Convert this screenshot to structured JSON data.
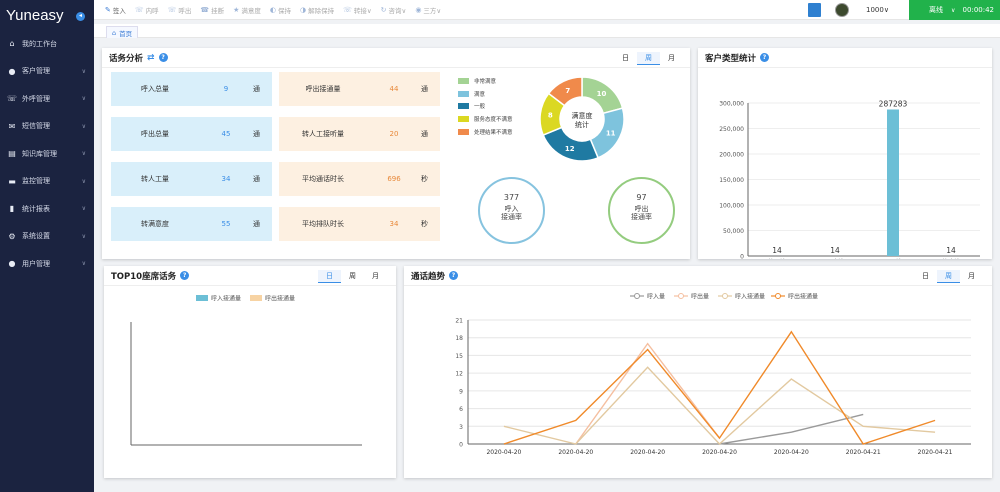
{
  "app": {
    "logo": "Yuneasy"
  },
  "sidebar": {
    "items": [
      {
        "label": "我的工作台",
        "icon": "home-icon",
        "glyph": "⌂",
        "arrow": ""
      },
      {
        "label": "客户管理",
        "icon": "user-icon",
        "glyph": "●",
        "arrow": "∨"
      },
      {
        "label": "外呼管理",
        "icon": "phone-icon",
        "glyph": "☏",
        "arrow": "∨"
      },
      {
        "label": "短信管理",
        "icon": "mail-icon",
        "glyph": "✉",
        "arrow": "∨"
      },
      {
        "label": "知识库管理",
        "icon": "knowledge-icon",
        "glyph": "▤",
        "arrow": "∨"
      },
      {
        "label": "监控管理",
        "icon": "monitor-icon",
        "glyph": "▬",
        "arrow": "∨"
      },
      {
        "label": "统计报表",
        "icon": "report-icon",
        "glyph": "▮",
        "arrow": "∨"
      },
      {
        "label": "系统设置",
        "icon": "settings-icon",
        "glyph": "⚙",
        "arrow": "∨"
      },
      {
        "label": "用户管理",
        "icon": "users-icon",
        "glyph": "●",
        "arrow": "∨"
      }
    ]
  },
  "toolbar": {
    "items": [
      {
        "label": "签入",
        "icon": "sign-in-icon",
        "glyph": "✎",
        "enabled": true
      },
      {
        "label": "内呼",
        "icon": "internal-call-icon",
        "glyph": "☏",
        "enabled": false
      },
      {
        "label": "呼出",
        "icon": "outbound-call-icon",
        "glyph": "☏",
        "enabled": false
      },
      {
        "label": "挂断",
        "icon": "hangup-icon",
        "glyph": "☎",
        "enabled": false
      },
      {
        "label": "满意度",
        "icon": "satisfaction-icon",
        "glyph": "★",
        "enabled": false
      },
      {
        "label": "保持",
        "icon": "hold-icon",
        "glyph": "◐",
        "enabled": false
      },
      {
        "label": "解除保持",
        "icon": "unhold-icon",
        "glyph": "◑",
        "enabled": false
      },
      {
        "label": "转接∨",
        "icon": "transfer-icon",
        "glyph": "☏",
        "enabled": false
      },
      {
        "label": "咨询∨",
        "icon": "consult-icon",
        "glyph": "↻",
        "enabled": false
      },
      {
        "label": "三方∨",
        "icon": "three-way-icon",
        "glyph": "◉",
        "enabled": false
      }
    ],
    "extension": "1000∨"
  },
  "status": {
    "label": "离线",
    "arrow": "∨",
    "timer": "00:00:42"
  },
  "breadcrumb": {
    "home": "首页"
  },
  "tabs_dwm": [
    "日",
    "周",
    "月"
  ],
  "call_analysis": {
    "title": "话务分析",
    "stats_left": [
      {
        "label": "呼入总量",
        "value": "9",
        "unit": "通"
      },
      {
        "label": "呼出总量",
        "value": "45",
        "unit": "通"
      },
      {
        "label": "转人工量",
        "value": "34",
        "unit": "通"
      },
      {
        "label": "转满意度",
        "value": "55",
        "unit": "通"
      }
    ],
    "stats_right": [
      {
        "label": "呼出接通量",
        "value": "44",
        "unit": "通"
      },
      {
        "label": "转人工接听量",
        "value": "20",
        "unit": "通"
      },
      {
        "label": "平均通话时长",
        "value": "696",
        "unit": "秒"
      },
      {
        "label": "平均排队时长",
        "value": "34",
        "unit": "秒"
      }
    ],
    "legend": [
      {
        "label": "非常满意",
        "color": "#a4d394"
      },
      {
        "label": "满意",
        "color": "#7ec3dd"
      },
      {
        "label": "一般",
        "color": "#1f7aa2"
      },
      {
        "label": "服务态度不满意",
        "color": "#dbd822"
      },
      {
        "label": "处理结果不满意",
        "color": "#f08a4b"
      }
    ],
    "donut": {
      "center": "满意度\n统计",
      "values": [
        10,
        11,
        12,
        8,
        7
      ]
    },
    "inbound_rate": {
      "value": "377",
      "label": "呼入\n接通率",
      "color": "#86c3df"
    },
    "outbound_rate": {
      "value": "97",
      "label": "呼出\n接通率",
      "color": "#94cc7f"
    }
  },
  "customer_stats": {
    "title": "客户类型统计",
    "chart_data": {
      "type": "bar",
      "categories": [
        "待回访",
        "已确认",
        "已回访",
        "待确认"
      ],
      "values": [
        14,
        14,
        287283,
        14
      ],
      "ylim": [
        0,
        300000
      ],
      "yticks": [
        "300,000",
        "250,000",
        "200,000",
        "150,000",
        "100,000",
        "50,000",
        "0"
      ],
      "color": "#6cbfd6"
    }
  },
  "top10": {
    "title": "TOP10座席话务",
    "chart_data": {
      "type": "bar",
      "series": [
        {
          "name": "呼入接通量",
          "color": "#6cbfd6",
          "values": []
        },
        {
          "name": "呼出接通量",
          "color": "#f7d3a3",
          "values": []
        }
      ],
      "categories": []
    }
  },
  "call_trend": {
    "title": "通话趋势",
    "chart_data": {
      "type": "line",
      "x": [
        "2020-04-20",
        "2020-04-20",
        "2020-04-20",
        "2020-04-20",
        "2020-04-20",
        "2020-04-21",
        "2020-04-21"
      ],
      "ylim": [
        0,
        21
      ],
      "yticks": [
        "21",
        "18",
        "15",
        "12",
        "9",
        "6",
        "3",
        "0"
      ],
      "series": [
        {
          "name": "呼入量",
          "color": "#9a9a9a",
          "values": [
            0,
            0,
            0,
            0,
            2,
            5,
            null
          ]
        },
        {
          "name": "呼出量",
          "color": "#f5bfa0",
          "values": [
            null,
            0,
            17,
            1,
            null,
            null,
            null
          ]
        },
        {
          "name": "呼入接通量",
          "color": "#e2c9a0",
          "values": [
            3,
            0,
            13,
            0,
            11,
            3,
            2
          ]
        },
        {
          "name": "呼出接通量",
          "color": "#f08a2a",
          "values": [
            0,
            4,
            16,
            1,
            19,
            0,
            4
          ]
        }
      ]
    }
  }
}
